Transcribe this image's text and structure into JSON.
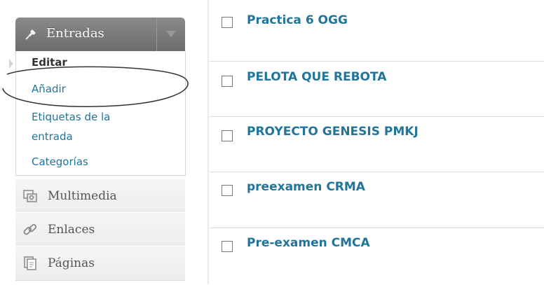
{
  "sidebar": {
    "posts_menu": {
      "label": "Entradas",
      "icon": "pin-icon",
      "toggle_icon": "chevron-down-icon",
      "subitems": [
        {
          "label": "Editar",
          "current": true
        },
        {
          "label": "Añadir"
        },
        {
          "label": "Etiquetas de la"
        },
        {
          "label": "entrada"
        },
        {
          "label": "Categorías"
        }
      ]
    },
    "items": [
      {
        "label": "Multimedia",
        "icon": "media-icon"
      },
      {
        "label": "Enlaces",
        "icon": "link-icon"
      },
      {
        "label": "Páginas",
        "icon": "pages-icon"
      }
    ]
  },
  "posts": [
    {
      "title": "Practica 6 OGG"
    },
    {
      "title": "PELOTA QUE REBOTA"
    },
    {
      "title": "PROYECTO GENESIS PMKJ"
    },
    {
      "title": "preexamen CRMA"
    },
    {
      "title": "Pre-examen CMCA"
    }
  ],
  "colors": {
    "link": "#21759b",
    "menu_header": "#777777"
  }
}
